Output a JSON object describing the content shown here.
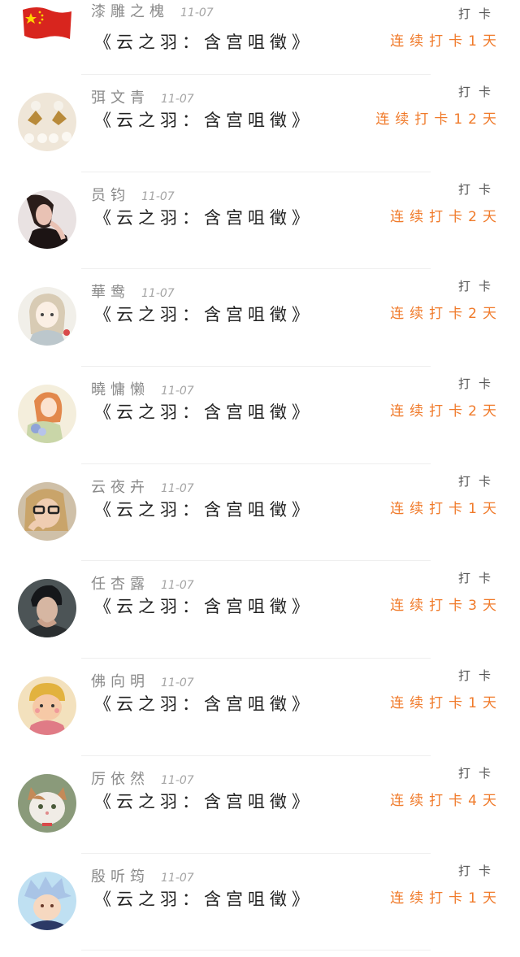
{
  "rows": [
    {
      "name": "漆雕之槐",
      "date": "11-07",
      "message": "《云之羽：含宫咀徵》",
      "action": "打卡",
      "streak": "连续打卡1天",
      "avatar": "china-flag-avatar"
    },
    {
      "name": "弭文青",
      "date": "11-07",
      "message": "《云之羽：含宫咀徵》",
      "action": "打卡",
      "streak": "连续打卡12天",
      "avatar": "earrings-avatar"
    },
    {
      "name": "员钧",
      "date": "11-07",
      "message": "《云之羽：含宫咀徵》",
      "action": "打卡",
      "streak": "连续打卡2天",
      "avatar": "woman-portrait-avatar"
    },
    {
      "name": "華鸯",
      "date": "11-07",
      "message": "《云之羽：含宫咀徵》",
      "action": "打卡",
      "streak": "连续打卡2天",
      "avatar": "anime-girl-avatar"
    },
    {
      "name": "曉慵懒",
      "date": "11-07",
      "message": "《云之羽：含宫咀徵》",
      "action": "打卡",
      "streak": "连续打卡2天",
      "avatar": "painted-girl-avatar"
    },
    {
      "name": "云夜卉",
      "date": "11-07",
      "message": "《云之羽：含宫咀徵》",
      "action": "打卡",
      "streak": "连续打卡1天",
      "avatar": "blonde-girl-avatar"
    },
    {
      "name": "任杏露",
      "date": "11-07",
      "message": "《云之羽：含宫咀徵》",
      "action": "打卡",
      "streak": "连续打卡3天",
      "avatar": "man-portrait-avatar"
    },
    {
      "name": "佛向明",
      "date": "11-07",
      "message": "《云之羽：含宫咀徵》",
      "action": "打卡",
      "streak": "连续打卡1天",
      "avatar": "cartoon-kid-avatar"
    },
    {
      "name": "厉依然",
      "date": "11-07",
      "message": "《云之羽：含宫咀徵》",
      "action": "打卡",
      "streak": "连续打卡4天",
      "avatar": "cat-avatar"
    },
    {
      "name": "殷听筠",
      "date": "11-07",
      "message": "《云之羽：含宫咀徵》",
      "action": "打卡",
      "streak": "连续打卡1天",
      "avatar": "anime-boy-avatar"
    }
  ],
  "colors": {
    "streak": "#f07a2a",
    "name": "#8a8a8a",
    "message": "#222222"
  }
}
